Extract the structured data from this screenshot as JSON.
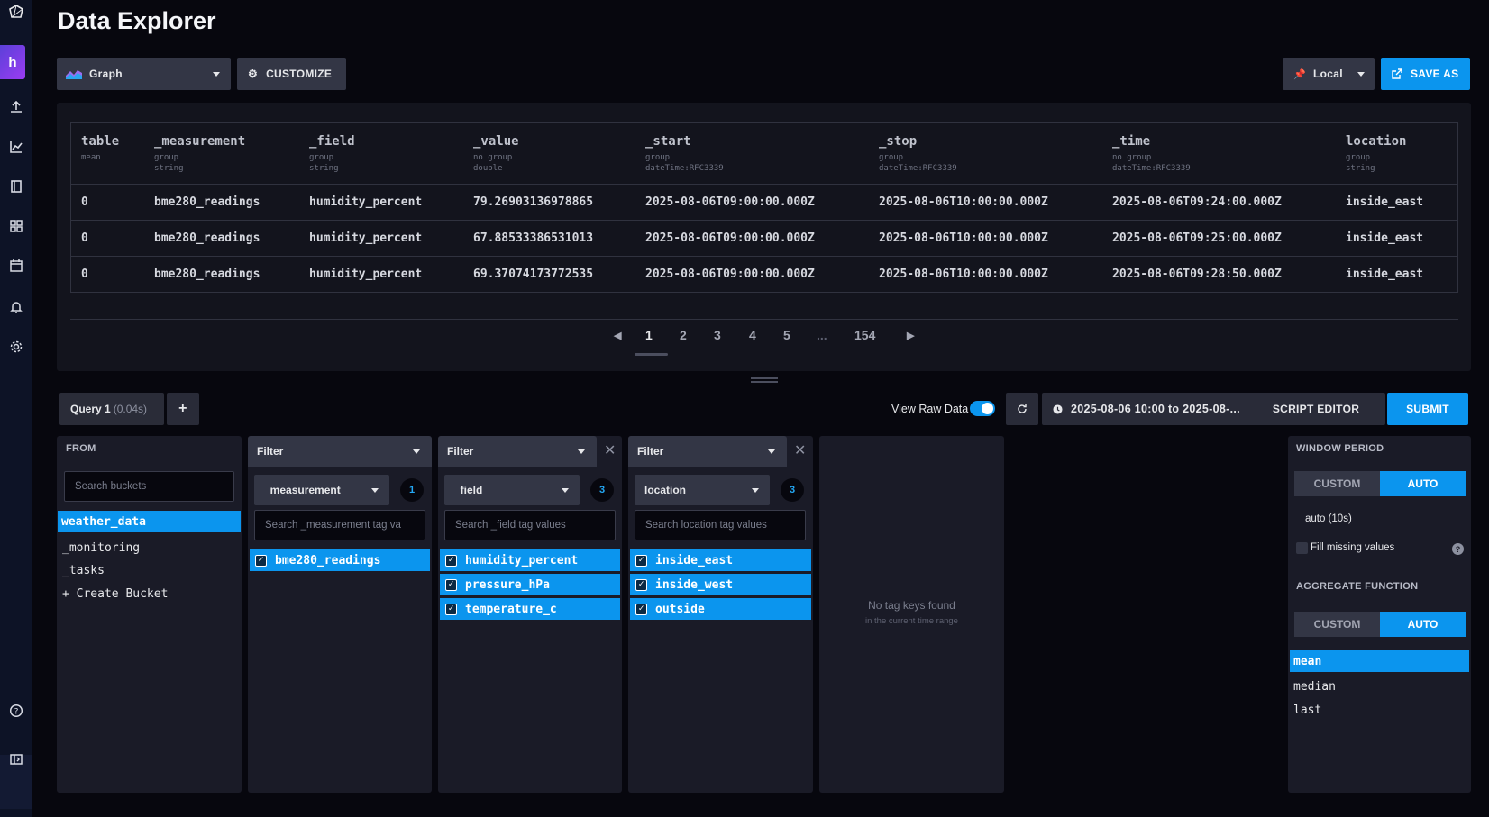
{
  "header": {
    "title": "Data Explorer"
  },
  "toolbar": {
    "view_type": "Graph",
    "customize_label": "CUSTOMIZE",
    "timezone": "Local",
    "save_as_label": "SAVE AS"
  },
  "sidebar": {
    "user_initial": "h"
  },
  "table": {
    "columns": [
      {
        "name": "table",
        "m1": "mean",
        "m2": ""
      },
      {
        "name": "_measurement",
        "m1": "group",
        "m2": "string"
      },
      {
        "name": "_field",
        "m1": "group",
        "m2": "string"
      },
      {
        "name": "_value",
        "m1": "no group",
        "m2": "double"
      },
      {
        "name": "_start",
        "m1": "group",
        "m2": "dateTime:RFC3339"
      },
      {
        "name": "_stop",
        "m1": "group",
        "m2": "dateTime:RFC3339"
      },
      {
        "name": "_time",
        "m1": "no group",
        "m2": "dateTime:RFC3339"
      },
      {
        "name": "location",
        "m1": "group",
        "m2": "string"
      }
    ],
    "rows": [
      [
        "0",
        "bme280_readings",
        "humidity_percent",
        "79.26903136978865",
        "2025-08-06T09:00:00.000Z",
        "2025-08-06T10:00:00.000Z",
        "2025-08-06T09:24:00.000Z",
        "inside_east"
      ],
      [
        "0",
        "bme280_readings",
        "humidity_percent",
        "67.88533386531013",
        "2025-08-06T09:00:00.000Z",
        "2025-08-06T10:00:00.000Z",
        "2025-08-06T09:25:00.000Z",
        "inside_east"
      ],
      [
        "0",
        "bme280_readings",
        "humidity_percent",
        "69.37074173772535",
        "2025-08-06T09:00:00.000Z",
        "2025-08-06T10:00:00.000Z",
        "2025-08-06T09:28:50.000Z",
        "inside_east"
      ]
    ]
  },
  "pagination": {
    "pages": [
      "1",
      "2",
      "3",
      "4",
      "5",
      "...",
      "154"
    ],
    "current": "1"
  },
  "query": {
    "tab_label": "Query 1",
    "tab_time": "(0.04s)",
    "add_label": "+",
    "view_raw_label": "View Raw Data",
    "time_range": "2025-08-06 10:00 to 2025-08-...",
    "script_editor_label": "SCRIPT EDITOR",
    "submit_label": "SUBMIT"
  },
  "from": {
    "title": "FROM",
    "search_placeholder": "Search buckets",
    "buckets": [
      "weather_data",
      "_monitoring",
      "_tasks",
      "+ Create Bucket"
    ]
  },
  "filters": [
    {
      "title": "Filter",
      "key": "_measurement",
      "count": "1",
      "placeholder": "Search _measurement tag va",
      "values": [
        "bme280_readings"
      ]
    },
    {
      "title": "Filter",
      "key": "_field",
      "count": "3",
      "placeholder": "Search _field tag values",
      "values": [
        "humidity_percent",
        "pressure_hPa",
        "temperature_c"
      ]
    },
    {
      "title": "Filter",
      "key": "location",
      "count": "3",
      "placeholder": "Search location tag values",
      "values": [
        "inside_east",
        "inside_west",
        "outside"
      ]
    }
  ],
  "empty_panel": {
    "title": "No tag keys found",
    "subtitle": "in the current time range"
  },
  "aggregate": {
    "window_title": "WINDOW PERIOD",
    "custom_label": "CUSTOM",
    "auto_label": "AUTO",
    "window_value": "auto (10s)",
    "fill_label": "Fill missing values",
    "function_title": "AGGREGATE FUNCTION",
    "functions": [
      "mean",
      "median",
      "last"
    ]
  },
  "colors": {
    "accent": "#0b95ee",
    "background": "#07070e",
    "panel": "#1a1b27"
  }
}
